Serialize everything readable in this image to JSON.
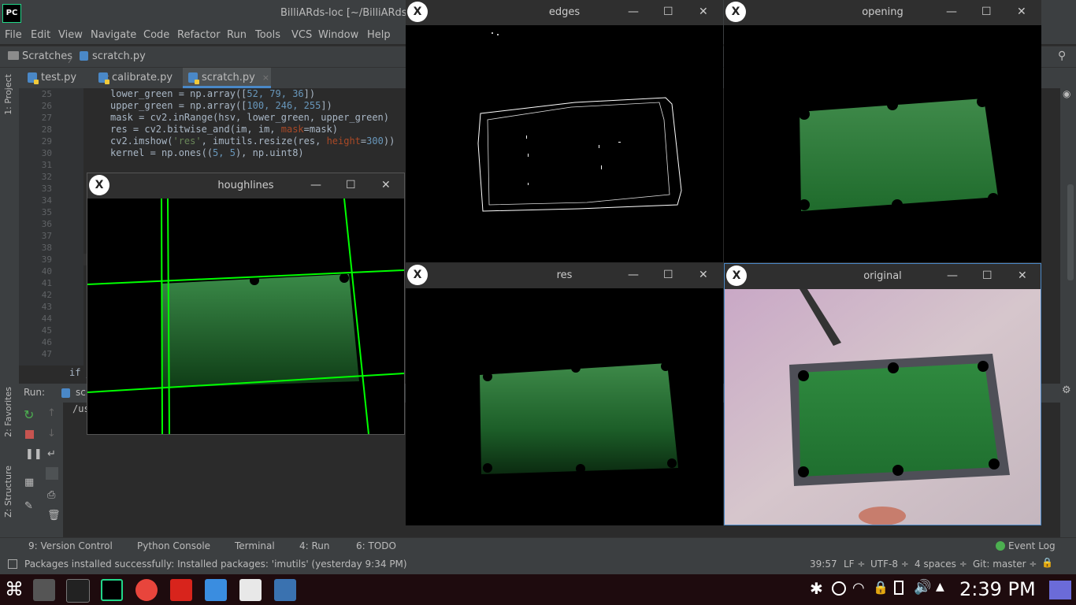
{
  "ide": {
    "title": "BilliARds-loc [~/BilliARds-lo",
    "logo": "PC",
    "menu": [
      "File",
      "Edit",
      "View",
      "Navigate",
      "Code",
      "Refactor",
      "Run",
      "Tools",
      "VCS",
      "Window",
      "Help"
    ],
    "breadcrumb": {
      "root": "Scratches",
      "sep": "〉",
      "file": "scratch.py"
    },
    "tabs": [
      {
        "label": "test.py",
        "close": "×"
      },
      {
        "label": "calibrate.py",
        "close": "×"
      },
      {
        "label": "scratch.py",
        "close": "×",
        "active": true
      }
    ],
    "left_stripe": {
      "project": "1: Project",
      "favorites": "2: Favorites",
      "structure": "Z: Structure"
    },
    "line_numbers": [
      "25",
      "26",
      "27",
      "28",
      "29",
      "30",
      "31",
      "32",
      "33",
      "34",
      "35",
      "36",
      "37",
      "38",
      "39",
      "40",
      "41",
      "42",
      "43",
      "44",
      "45",
      "46",
      "47"
    ],
    "code_lines": [
      {
        "t1": "lower_green = np.array([",
        "n1": "52, 79, 36",
        "t2": "])"
      },
      {
        "t1": "upper_green = np.array([",
        "n1": "100, 246, 255",
        "t2": "])"
      },
      {
        "t1": "mask = cv2.inRange(hsv, lower_green, upper_green)"
      },
      {
        "t1": "res = cv2.bitwise_and(im, im, ",
        "k1": "mask",
        "t2": "=mask)"
      },
      {
        "t1": "cv2.imshow(",
        "s1": "'res'",
        "t2": ", imutils.resize(res, ",
        "k1": "height",
        "t3": "=",
        "n1": "300",
        "t4": "))"
      },
      {
        "t1": "kernel = np.ones((",
        "n1": "5, 5",
        "t2": "), np.uint8)"
      }
    ],
    "if_text": "if __",
    "run": {
      "label": "Run:",
      "tab": "scr",
      "output": "/us"
    },
    "bottom_tabs": [
      "9: Version Control",
      "Python Console",
      "Terminal",
      "4: Run",
      "6: TODO",
      "Event Log"
    ],
    "status": {
      "message": "Packages installed successfully: Installed packages: 'imutils' (yesterday 9:34 PM)",
      "position": "39:57",
      "line_sep": "LF ÷",
      "encoding": "UTF-8 ÷",
      "indent": "4 spaces ÷",
      "git": "Git: master ÷"
    }
  },
  "windows": {
    "edges": "edges",
    "opening": "opening",
    "res": "res",
    "original": "original",
    "houghlines": "houghlines",
    "controls": {
      "min": "—",
      "max": "☐",
      "close": "✕"
    },
    "logo": "X"
  },
  "taskbar": {
    "clock": "2:39 PM",
    "apps": [
      "app-menu-icon",
      "file-manager-icon",
      "terminal-icon",
      "pycharm-icon",
      "chrome-icon",
      "pdf-icon",
      "finder-icon",
      "slides-icon",
      "python-icon"
    ],
    "tray": [
      "settings-icon",
      "media-icon",
      "wifi-icon",
      "lock-icon",
      "clipboard-icon",
      "volume-icon",
      "arrow-up-icon"
    ]
  },
  "colors": {
    "felt": "#2e7d3a",
    "line": "#00ff00",
    "accent": "#4a88c7"
  }
}
